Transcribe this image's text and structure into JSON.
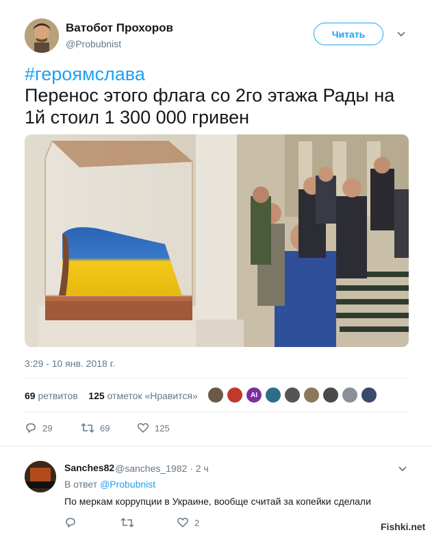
{
  "tweet": {
    "author_name": "Ватобот Прохоров",
    "author_handle": "@Probubnist",
    "follow_label": "Читать",
    "hashtag": "#героямслава",
    "text": "Перенос этого флага со 2го этажа Рады на 1й стоил 1 300 000 гривен",
    "timestamp": "3:29 - 10 янв. 2018 г.",
    "retweets_count": "69",
    "retweets_label": "ретвитов",
    "likes_count": "125",
    "likes_label": "отметок «Нравится»",
    "liker_avatars": [
      "avatar-1",
      "avatar-2",
      "avatar-3",
      "avatar-4",
      "avatar-5",
      "avatar-6",
      "avatar-7",
      "avatar-8",
      "avatar-9"
    ],
    "liker_badge_text": "AI",
    "actions": {
      "replies": "29",
      "retweets": "69",
      "likes": "125"
    }
  },
  "reply": {
    "author_name": "Sanches82",
    "author_handle": "@sanches_1982",
    "time": "· 2 ч",
    "in_reply_prefix": "В ответ",
    "in_reply_handle": "@Probubnist",
    "text": "По меркам коррупции в Украине, вообще считай за копейки сделали",
    "likes": "2"
  },
  "watermark": "Fishki.net",
  "colors": {
    "accent": "#1da1f2",
    "text": "#14171a",
    "muted": "#657786",
    "divider": "#e6ecf0"
  }
}
